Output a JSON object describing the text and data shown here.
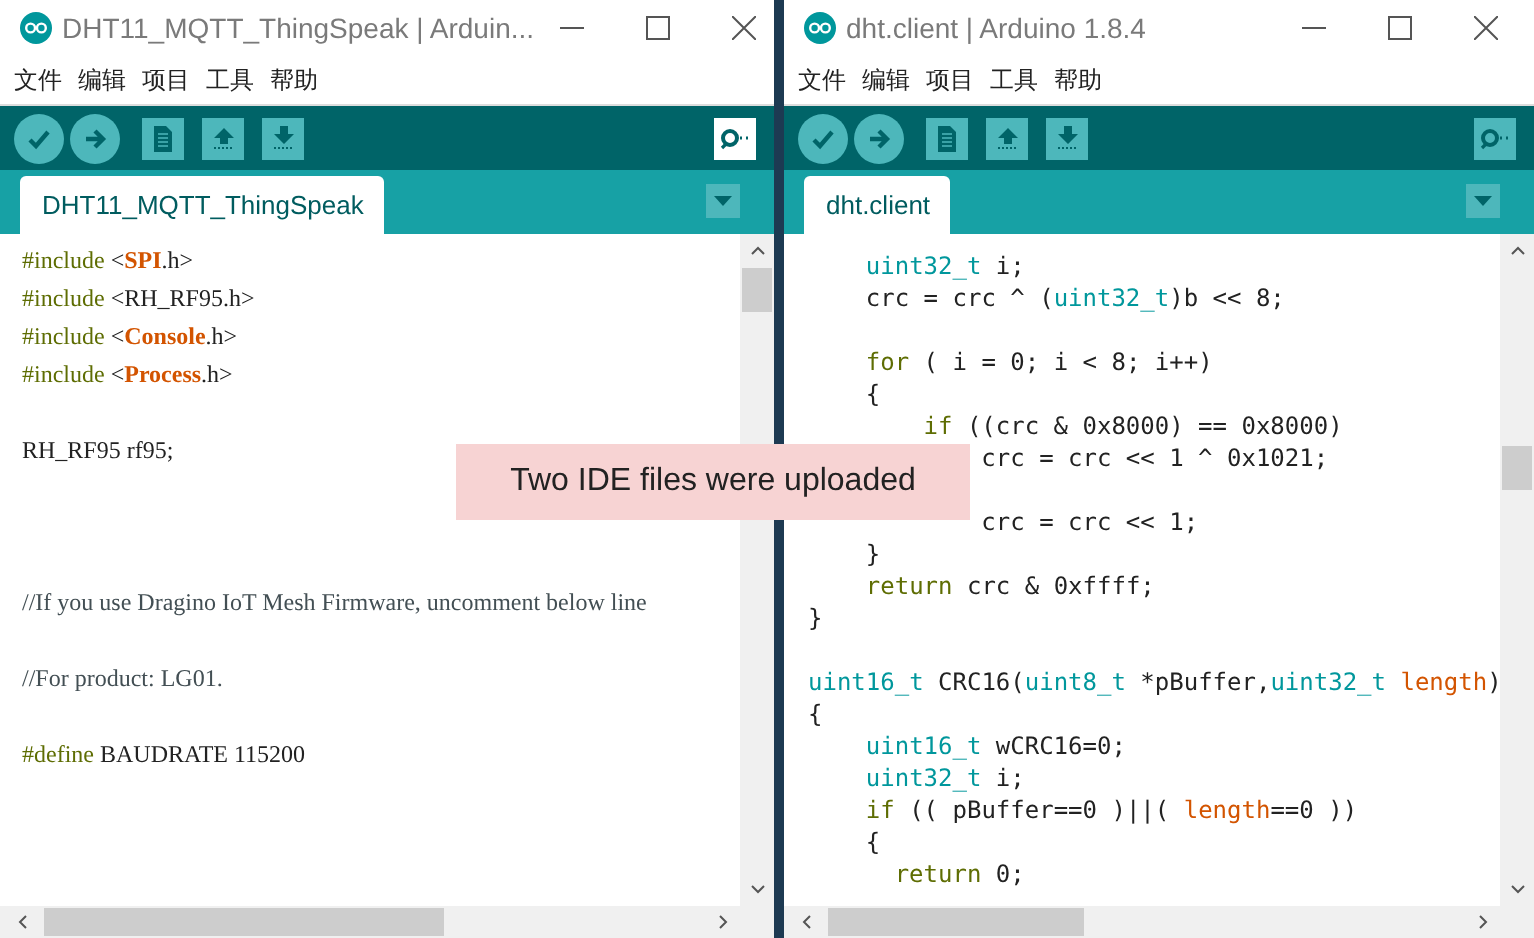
{
  "windows": [
    {
      "title": "DHT11_MQTT_ThingSpeak | Arduin...",
      "menu": [
        "文件",
        "编辑",
        "项目",
        "工具",
        "帮助"
      ],
      "serial_monitor_highlighted": true,
      "tab": "DHT11_MQTT_ThingSpeak",
      "lines": [
        {
          "kind": "code",
          "segments": [
            {
              "text": "#include ",
              "kind": "keyword"
            },
            {
              "text": "<",
              "kind": "plain"
            },
            {
              "text": "SPI",
              "kind": "lib"
            },
            {
              "text": ".h>",
              "kind": "plain"
            }
          ]
        },
        {
          "kind": "code",
          "segments": [
            {
              "text": "#include ",
              "kind": "keyword"
            },
            {
              "text": "<RH_RF95.h>",
              "kind": "plain"
            }
          ]
        },
        {
          "kind": "code",
          "segments": [
            {
              "text": "#include ",
              "kind": "keyword"
            },
            {
              "text": "<",
              "kind": "plain"
            },
            {
              "text": "Console",
              "kind": "lib"
            },
            {
              "text": ".h>",
              "kind": "plain"
            }
          ]
        },
        {
          "kind": "code",
          "segments": [
            {
              "text": "#include ",
              "kind": "keyword"
            },
            {
              "text": "<",
              "kind": "plain"
            },
            {
              "text": "Process",
              "kind": "lib"
            },
            {
              "text": ".h>",
              "kind": "plain"
            }
          ]
        },
        {
          "kind": "blank"
        },
        {
          "kind": "code",
          "segments": [
            {
              "text": "RH_RF95 rf95;",
              "kind": "plain"
            }
          ]
        },
        {
          "kind": "blank"
        },
        {
          "kind": "blank"
        },
        {
          "kind": "blank"
        },
        {
          "kind": "code",
          "segments": [
            {
              "text": "//If you use Dragino IoT Mesh Firmware, uncomment below line",
              "kind": "comment"
            }
          ]
        },
        {
          "kind": "blank"
        },
        {
          "kind": "code",
          "segments": [
            {
              "text": "//For product: LG01.",
              "kind": "comment"
            }
          ]
        },
        {
          "kind": "blank"
        },
        {
          "kind": "code",
          "segments": [
            {
              "text": "#define ",
              "kind": "keyword"
            },
            {
              "text": "BAUDRATE 115200",
              "kind": "plain"
            }
          ]
        }
      ]
    },
    {
      "title": "dht.client | Arduino 1.8.4",
      "menu": [
        "文件",
        "编辑",
        "项目",
        "工具",
        "帮助"
      ],
      "serial_monitor_highlighted": false,
      "tab": "dht.client",
      "lines": [
        {
          "kind": "block",
          "children": [
            {
              "kind": "code",
              "segments": [
                {
                  "text": "uint32_t",
                  "kind": "type"
                },
                {
                  "text": " i;",
                  "kind": "plain"
                }
              ]
            },
            {
              "kind": "code",
              "segments": [
                {
                  "text": "crc = crc ^ (",
                  "kind": "plain"
                },
                {
                  "text": "uint32_t",
                  "kind": "type"
                },
                {
                  "text": ")b << 8;",
                  "kind": "plain"
                }
              ]
            },
            {
              "kind": "blank"
            },
            {
              "kind": "code",
              "segments": [
                {
                  "text": "for",
                  "kind": "keyword"
                },
                {
                  "text": " ( i = 0; i < 8; i++)",
                  "kind": "plain"
                }
              ]
            },
            {
              "kind": "code",
              "segments": [
                {
                  "text": "{",
                  "kind": "plain"
                }
              ]
            },
            {
              "kind": "block",
              "children": [
                {
                  "kind": "code",
                  "segments": [
                    {
                      "text": "if",
                      "kind": "keyword"
                    },
                    {
                      "text": " ((crc & 0x8000) == 0x8000)",
                      "kind": "plain"
                    }
                  ]
                },
                {
                  "kind": "block",
                  "children": [
                    {
                      "kind": "code",
                      "segments": [
                        {
                          "text": "crc = crc << 1 ^ 0x1021;",
                          "kind": "plain"
                        }
                      ]
                    },
                    {
                      "kind": "blank"
                    },
                    {
                      "kind": "code",
                      "segments": [
                        {
                          "text": "crc = crc << 1;",
                          "kind": "plain"
                        }
                      ]
                    }
                  ]
                }
              ]
            },
            {
              "kind": "code",
              "segments": [
                {
                  "text": "}",
                  "kind": "plain"
                }
              ]
            },
            {
              "kind": "code",
              "segments": [
                {
                  "text": "return",
                  "kind": "keyword"
                },
                {
                  "text": " crc & 0xffff;",
                  "kind": "plain"
                }
              ]
            }
          ]
        },
        {
          "kind": "code",
          "segments": [
            {
              "text": "}",
              "kind": "plain"
            }
          ]
        },
        {
          "kind": "blank"
        },
        {
          "kind": "code",
          "segments": [
            {
              "text": "uint16_t",
              "kind": "type"
            },
            {
              "text": " CRC16(",
              "kind": "plain"
            },
            {
              "text": "uint8_t",
              "kind": "type"
            },
            {
              "text": " *pBuffer,",
              "kind": "plain"
            },
            {
              "text": "uint32_t",
              "kind": "type"
            },
            {
              "text": " length",
              "kind": "variable"
            },
            {
              "text": ")",
              "kind": "plain"
            }
          ]
        },
        {
          "kind": "code",
          "segments": [
            {
              "text": "{",
              "kind": "plain"
            }
          ]
        },
        {
          "kind": "block",
          "children": [
            {
              "kind": "code",
              "segments": [
                {
                  "text": "uint16_t",
                  "kind": "type"
                },
                {
                  "text": " wCRC16=0;",
                  "kind": "plain"
                }
              ]
            },
            {
              "kind": "code",
              "segments": [
                {
                  "text": "uint32_t",
                  "kind": "type"
                },
                {
                  "text": " i;",
                  "kind": "plain"
                }
              ]
            },
            {
              "kind": "code",
              "segments": [
                {
                  "text": "if",
                  "kind": "keyword"
                },
                {
                  "text": " (( pBuffer==0 )||( ",
                  "kind": "plain"
                },
                {
                  "text": "length",
                  "kind": "variable"
                },
                {
                  "text": "==0 ))",
                  "kind": "plain"
                }
              ]
            },
            {
              "kind": "code",
              "segments": [
                {
                  "text": "{",
                  "kind": "plain"
                }
              ]
            },
            {
              "kind": "half_block",
              "children": [
                {
                  "kind": "code",
                  "segments": [
                    {
                      "text": "return",
                      "kind": "keyword"
                    },
                    {
                      "text": " 0;",
                      "kind": "plain"
                    }
                  ]
                }
              ]
            }
          ]
        }
      ]
    }
  ],
  "notice": "Two IDE files were uploaded"
}
